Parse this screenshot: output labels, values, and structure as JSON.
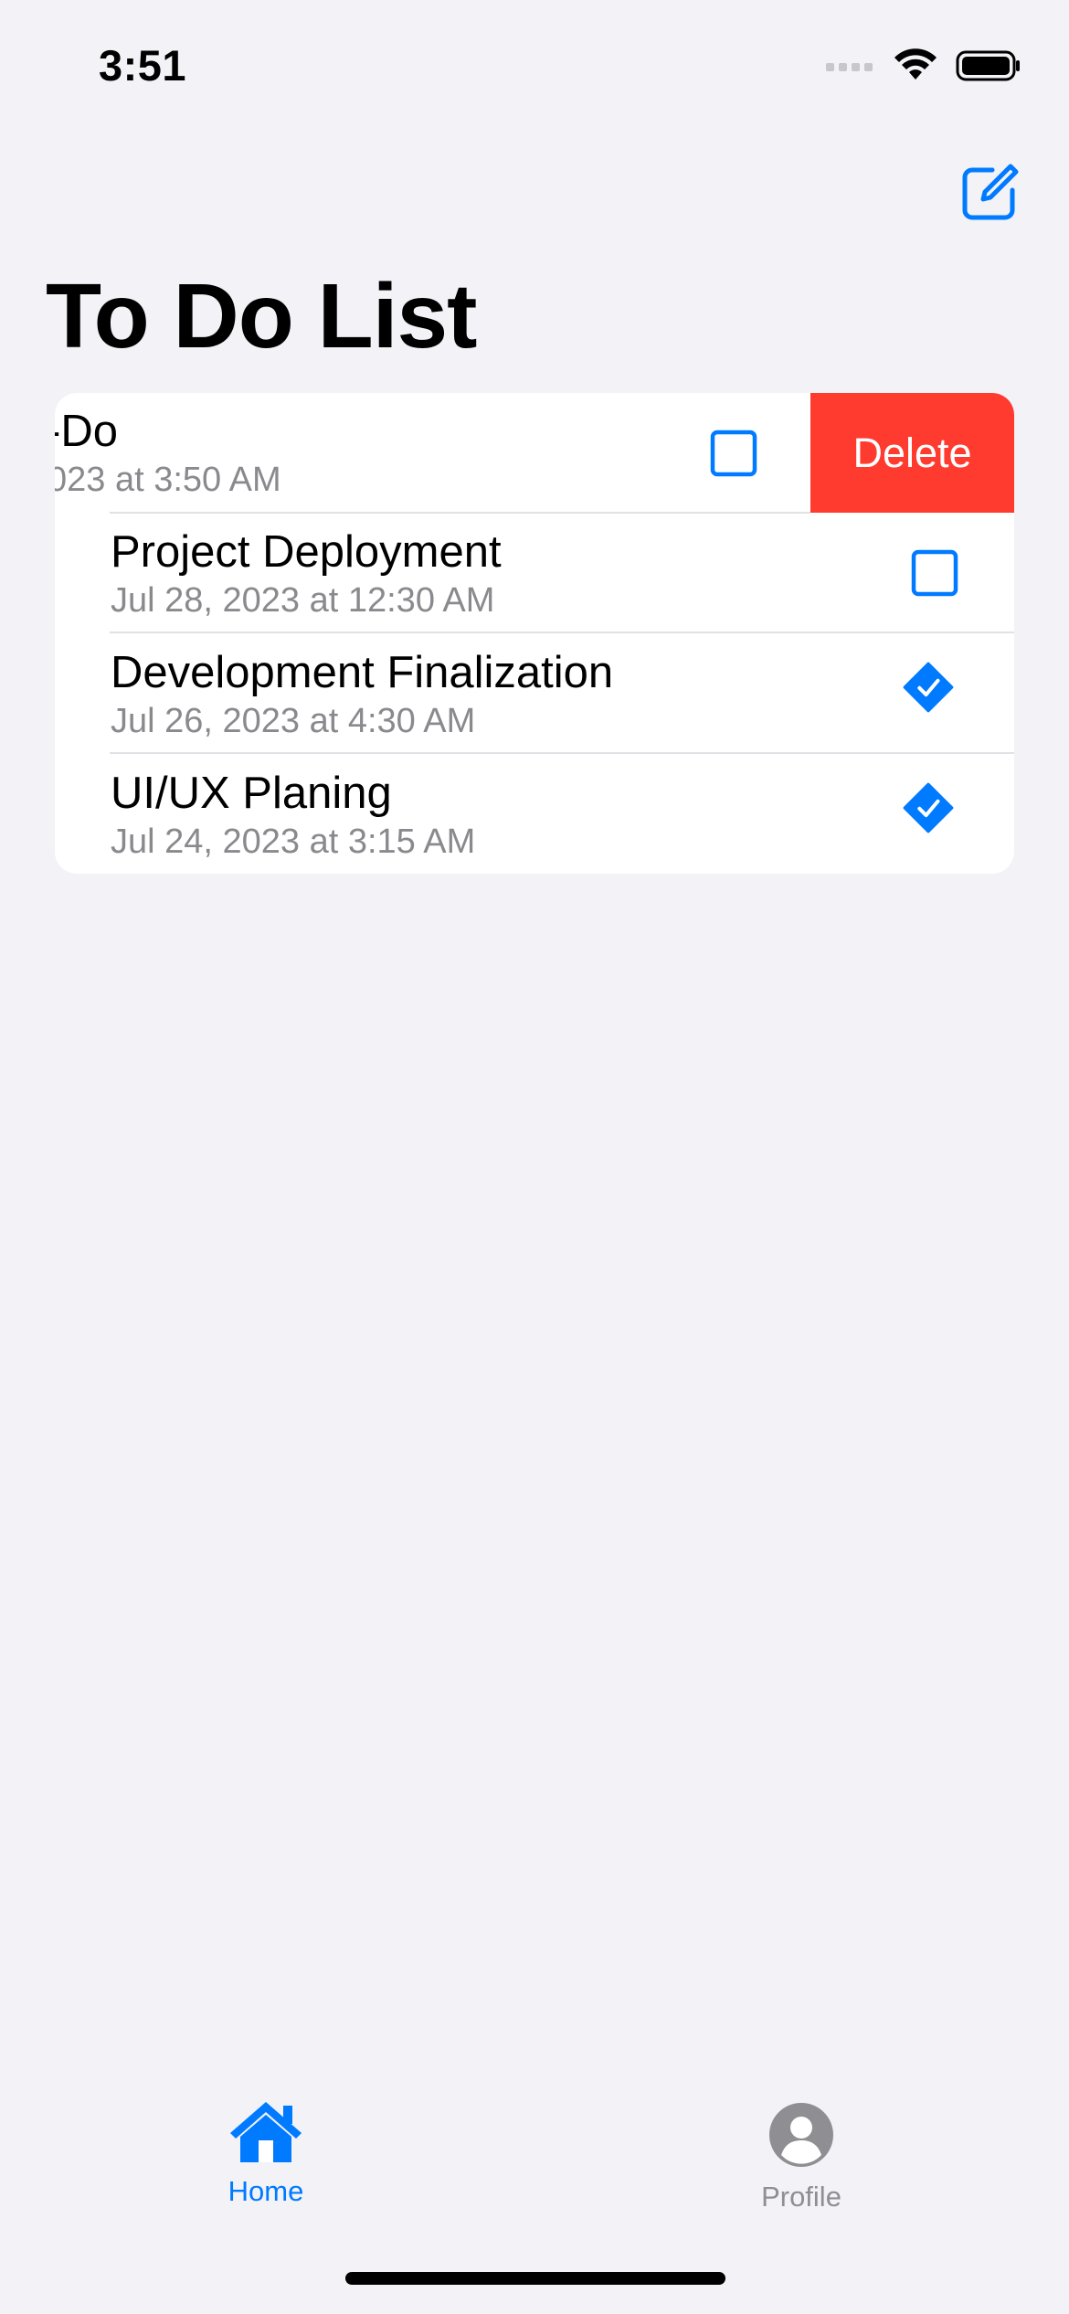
{
  "status_bar": {
    "time": "3:51"
  },
  "header": {
    "title": "To Do List",
    "compose_icon": "square-and-pencil-icon"
  },
  "colors": {
    "accent": "#007AFF",
    "destructive": "#FF3B30",
    "background": "#F2F2F7",
    "secondary_text": "#8A8A8E"
  },
  "todos": [
    {
      "title": "-Do",
      "date": "023 at 3:50 AM",
      "done": false,
      "swiped": true
    },
    {
      "title": "Project Deployment",
      "date": "Jul 28, 2023 at 12:30 AM",
      "done": false
    },
    {
      "title": "Development Finalization",
      "date": "Jul 26, 2023 at 4:30 AM",
      "done": true
    },
    {
      "title": "UI/UX Planing",
      "date": "Jul 24, 2023 at 3:15 AM",
      "done": true
    }
  ],
  "swipe_action": {
    "label": "Delete"
  },
  "tab_bar": {
    "tabs": [
      {
        "label": "Home",
        "icon": "house-icon",
        "selected": true
      },
      {
        "label": "Profile",
        "icon": "person-circle-icon",
        "selected": false
      }
    ]
  }
}
